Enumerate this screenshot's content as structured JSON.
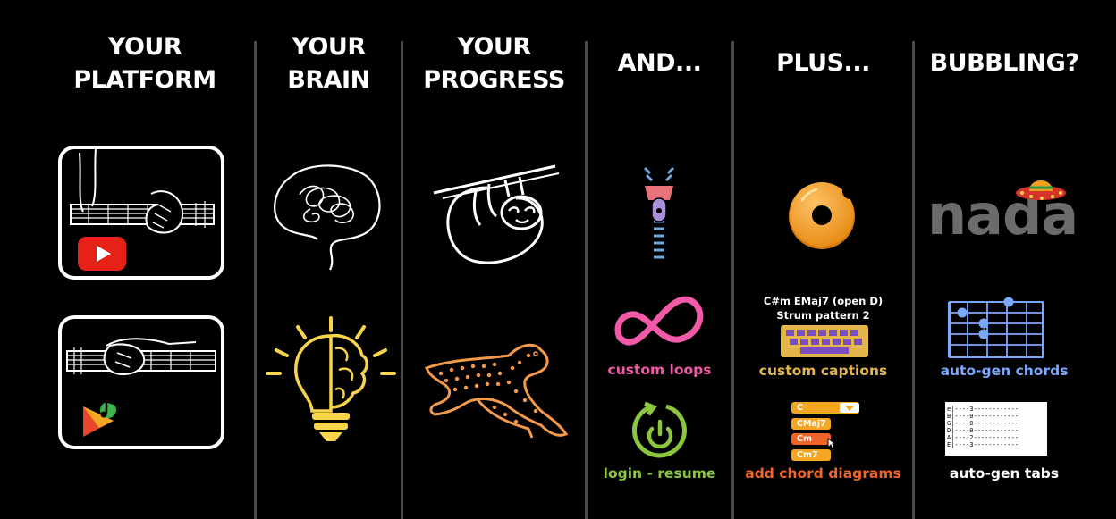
{
  "columns": [
    {
      "id": "platform",
      "title_lines": [
        "YOUR",
        "PLATFORM"
      ]
    },
    {
      "id": "brain",
      "title_lines": [
        "YOUR",
        "BRAIN"
      ]
    },
    {
      "id": "progress",
      "title_lines": [
        "YOUR",
        "PROGRESS"
      ]
    },
    {
      "id": "and",
      "title_lines": [
        "AND..."
      ]
    },
    {
      "id": "plus",
      "title_lines": [
        "PLUS..."
      ]
    },
    {
      "id": "bubbling",
      "title_lines": [
        "BUBBLING?"
      ]
    }
  ],
  "and_column": {
    "loops_caption": "custom loops",
    "login_caption": "login - resume"
  },
  "plus_column": {
    "caption_line1": "C#m  EMaj7 (open D)",
    "caption_line2": "Strum pattern 2",
    "captions_caption": "custom captions",
    "chord_options": [
      "C",
      "CMaj7",
      "Cm",
      "Cm7"
    ],
    "chord_caption": "add chord diagrams"
  },
  "bubbling_column": {
    "nada_text": "nada",
    "chords_caption": "auto-gen chords",
    "tab_lines": [
      "e|----3------------",
      "B|----0------------",
      "G|----0------------",
      "D|----0------------",
      "A|----2------------",
      "E|----3------------"
    ],
    "tabs_caption": "auto-gen tabs"
  },
  "colors": {
    "background": "#000000",
    "divider": "#4a4a4a",
    "loops_pink": "#f05aa6",
    "login_green": "#8cc63f",
    "captions_gold": "#e2b64a",
    "chord_red": "#f0642a",
    "chord_orange": "#f5a623",
    "autogen_blue": "#7aa7ff",
    "bulb_yellow": "#f7d44a",
    "cheetah_orange": "#f39a4a",
    "youtube_red": "#e62117"
  },
  "icons": [
    "youtube-icon",
    "music-app-icon",
    "scribble-brain-icon",
    "lightbulb-brain-icon",
    "sloth-icon",
    "cheetah-icon",
    "zipper-icon",
    "infinity-icon",
    "power-icon",
    "donut-icon",
    "keyboard-icon",
    "sombrero-icon",
    "chord-diagram-icon",
    "tab-sheet-icon"
  ]
}
